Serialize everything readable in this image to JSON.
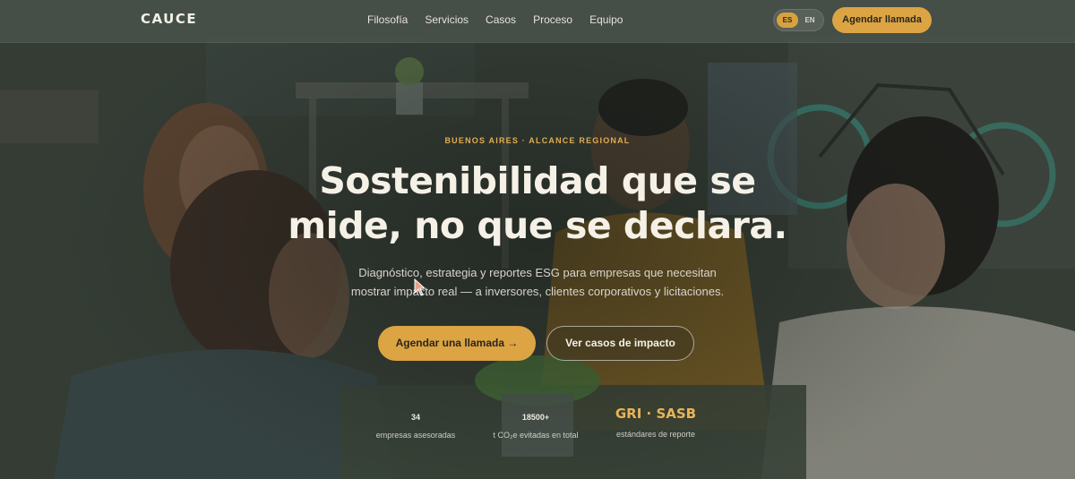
{
  "nav": {
    "logo": "CAUCE",
    "links": [
      "Filosofía",
      "Servicios",
      "Casos",
      "Proceso",
      "Equipo"
    ],
    "lang_active": "ES",
    "lang_other": "EN",
    "cta": "Agendar llamada"
  },
  "hero": {
    "eyebrow": "BUENOS AIRES · ALCANCE REGIONAL",
    "headline_line1": "Sostenibilidad que se",
    "headline_line2": "mide, no que se declara.",
    "sub_line1": "Diagnóstico, estrategia y reportes ESG para empresas que necesitan",
    "sub_line2": "mostrar impacto real — a inversores, clientes corporativos y licitaciones.",
    "primary_cta": "Agendar una llamada →",
    "secondary_cta": "Ver casos de impacto"
  },
  "stats": [
    {
      "value": "34",
      "label": "empresas asesoradas"
    },
    {
      "value": "18500+",
      "label": "t CO₂e evitadas en total"
    },
    {
      "value": "GRI · SASB",
      "label": "estándares de reporte"
    }
  ],
  "colors": {
    "accent": "#dca443",
    "nav_bg": "#48504a",
    "hero_overlay": "#2c332c"
  },
  "icons": {
    "cursor": "mouse-pointer-icon"
  }
}
